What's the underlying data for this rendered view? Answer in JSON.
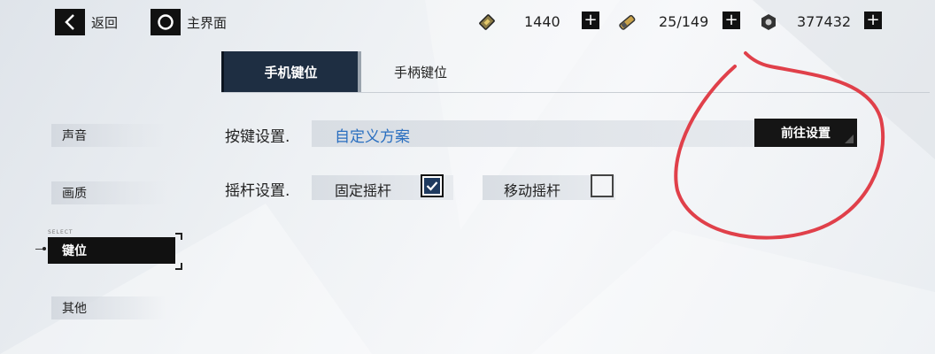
{
  "topbar": {
    "back_label": "返回",
    "home_label": "主界面",
    "resources": [
      {
        "icon": "ticket-icon",
        "value": "1440"
      },
      {
        "icon": "ammo-icon",
        "value": "25/149"
      },
      {
        "icon": "hex-nut-icon",
        "value": "377432"
      }
    ],
    "plus_symbol": "+"
  },
  "tabs": [
    {
      "label": "手机键位",
      "active": true
    },
    {
      "label": "手柄键位",
      "active": false
    }
  ],
  "sidebar": {
    "select_tag": "SELECT",
    "items": [
      {
        "label": "声音"
      },
      {
        "label": "画质"
      },
      {
        "label": "键位"
      },
      {
        "label": "其他"
      }
    ]
  },
  "settings": {
    "key_label": "按键设置.",
    "key_scheme": "自定义方案",
    "goto_label": "前往设置",
    "stick_label": "摇杆设置.",
    "fixed_stick": "固定摇杆",
    "fixed_checked": true,
    "move_stick": "移动摇杆",
    "move_checked": false
  },
  "colors": {
    "accent_blue": "#2a6fc0",
    "tab_active": "#1e2e42",
    "annotation_red": "#e0404a"
  }
}
